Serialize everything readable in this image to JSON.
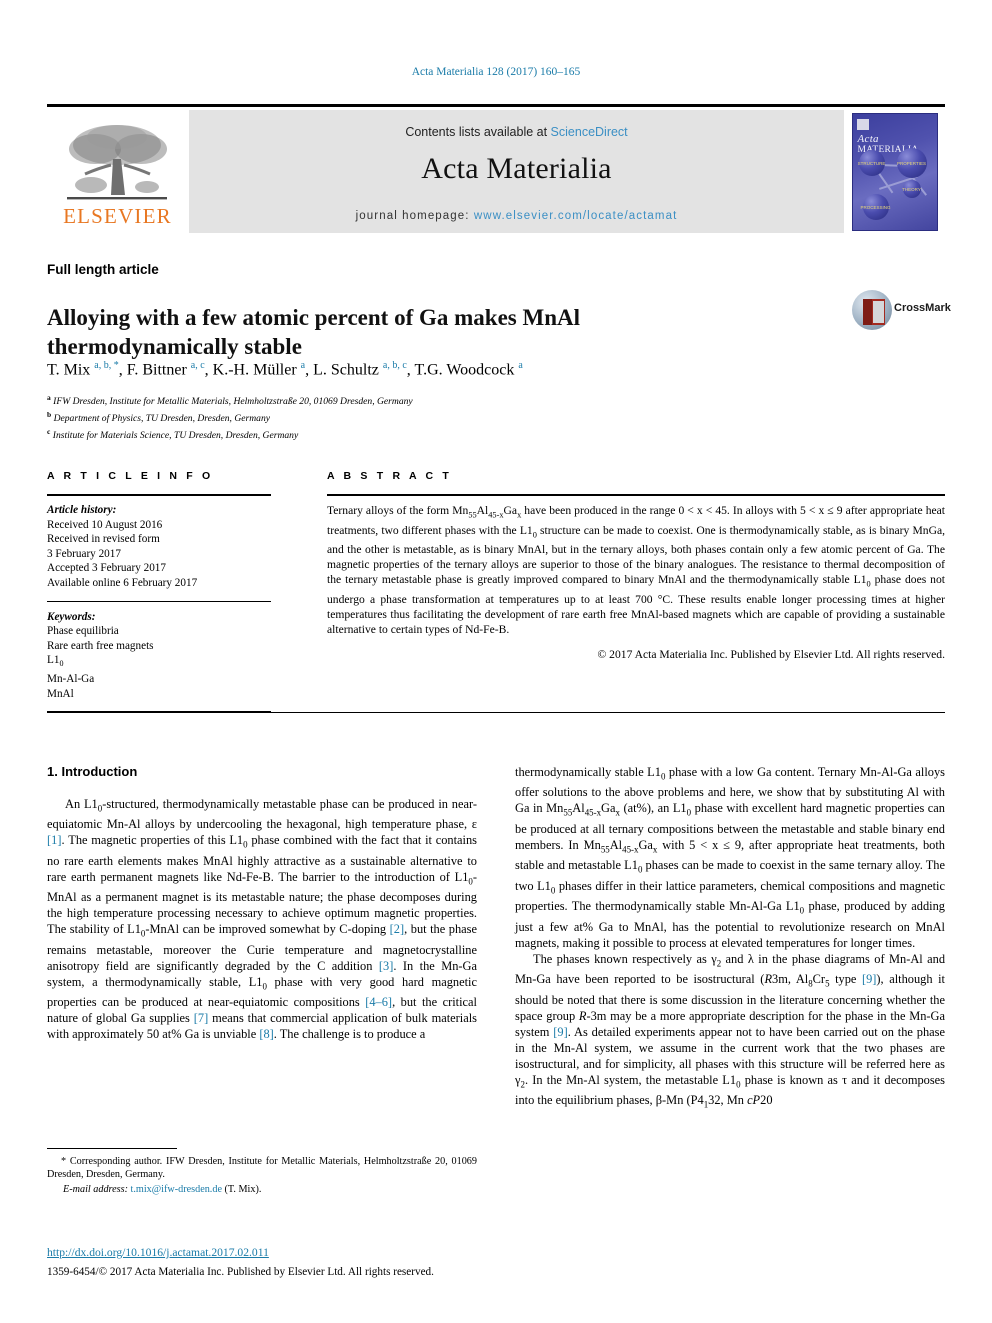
{
  "running_head": "Acta Materialia 128 (2017) 160–165",
  "masthead": {
    "publisher_logo_label": "ELSEVIER",
    "contents_prefix": "Contents lists available at ",
    "contents_link": "ScienceDirect",
    "journal_title": "Acta Materialia",
    "homepage_prefix": "journal homepage: ",
    "homepage_url": "www.elsevier.com/locate/actamat",
    "cover": {
      "title_italic": "Acta",
      "title_rest": "MATERIALIA",
      "node_labels": [
        "STRUCTURE",
        "PROPERTIES",
        "THEORY",
        "PROCESSING"
      ]
    }
  },
  "article": {
    "type": "Full length article",
    "title": "Alloying with a few atomic percent of Ga makes MnAl thermodynamically stable",
    "authors_html": "T. Mix <sup>a, b, *</sup>, F. Bittner <sup>a, c</sup>, K.-H. Müller <sup>a</sup>, L. Schultz <sup>a, b, c</sup>, T.G. Woodcock <sup>a</sup>",
    "affiliations": [
      {
        "marker": "a",
        "text": "IFW Dresden, Institute for Metallic Materials, Helmholtzstraße 20, 01069 Dresden, Germany"
      },
      {
        "marker": "b",
        "text": "Department of Physics, TU Dresden, Dresden, Germany"
      },
      {
        "marker": "c",
        "text": "Institute for Materials Science, TU Dresden, Dresden, Germany"
      }
    ],
    "crossmark_label": "CrossMark"
  },
  "info_section": {
    "heading": "A R T I C L E   I N F O",
    "history_label": "Article history:",
    "history_lines": [
      "Received 10 August 2016",
      "Received in revised form",
      "3 February 2017",
      "Accepted 3 February 2017",
      "Available online 6 February 2017"
    ],
    "keywords_label": "Keywords:",
    "keywords_html": [
      "Phase equilibria",
      "Rare earth free magnets",
      "L1<sub>0</sub>",
      "Mn-Al-Ga",
      "MnAl"
    ]
  },
  "abstract_section": {
    "heading": "A B S T R A C T",
    "body_html": "Ternary alloys of the form Mn<sub>55</sub>Al<sub>45-x</sub>Ga<sub>x</sub> have been produced in the range 0 &lt; x &lt; 45. In alloys with 5 &lt; x ≤ 9 after appropriate heat treatments, two different phases with the L1<sub>0</sub> structure can be made to coexist. One is thermodynamically stable, as is binary MnGa, and the other is metastable, as is binary MnAl, but in the ternary alloys, both phases contain only a few atomic percent of Ga. The magnetic properties of the ternary alloys are superior to those of the binary analogues. The resistance to thermal decomposition of the ternary metastable phase is greatly improved compared to binary MnAl and the thermodynamically stable L1<sub>0</sub> phase does not undergo a phase transformation at temperatures up to at least 700 °C. These results enable longer processing times at higher temperatures thus facilitating the development of rare earth free MnAl-based magnets which are capable of providing a sustainable alternative to certain types of Nd-Fe-B.",
    "copyright": "© 2017 Acta Materialia Inc. Published by Elsevier Ltd. All rights reserved."
  },
  "body": {
    "section_heading": "1. Introduction",
    "left_paragraph_html": "An L1<sub>0</sub>-structured, thermodynamically metastable phase can be produced in near-equiatomic Mn-Al alloys by undercooling the hexagonal, high temperature phase, ε <span class=\"ref\">[1]</span>. The magnetic properties of this L1<sub>0</sub> phase combined with the fact that it contains no rare earth elements makes MnAl highly attractive as a sustainable alternative to rare earth permanent magnets like Nd-Fe-B. The barrier to the introduction of L1<sub>0</sub>-MnAl as a permanent magnet is its metastable nature; the phase decomposes during the high temperature processing necessary to achieve optimum magnetic properties. The stability of L1<sub>0</sub>-MnAl can be improved somewhat by C-doping <span class=\"ref\">[2]</span>, but the phase remains metastable, moreover the Curie temperature and magnetocrystalline anisotropy field are significantly degraded by the C addition <span class=\"ref\">[3]</span>. In the Mn-Ga system, a thermodynamically stable, L1<sub>0</sub> phase with very good hard magnetic properties can be produced at near-equiatomic compositions <span class=\"ref\">[4–6]</span>, but the critical nature of global Ga supplies <span class=\"ref\">[7]</span> means that commercial application of bulk materials with approximately 50 at% Ga is unviable <span class=\"ref\">[8]</span>. The challenge is to produce a",
    "right_paragraph1_html": "thermodynamically stable L1<sub>0</sub> phase with a low Ga content. Ternary Mn-Al-Ga alloys offer solutions to the above problems and here, we show that by substituting Al with Ga in Mn<sub>55</sub>Al<sub>45-x</sub>Ga<sub>x</sub> (at%), an L1<sub>0</sub> phase with excellent hard magnetic properties can be produced at all ternary compositions between the metastable and stable binary end members. In Mn<sub>55</sub>Al<sub>45-x</sub>Ga<sub>x</sub> with 5 &lt; x ≤ 9, after appropriate heat treatments, both stable and metastable L1<sub>0</sub> phases can be made to coexist in the same ternary alloy. The two L1<sub>0</sub> phases differ in their lattice parameters, chemical compositions and magnetic properties. The thermodynamically stable Mn-Al-Ga L1<sub>0</sub> phase, produced by adding just a few at% Ga to MnAl, has the potential to revolutionize research on MnAl magnets, making it possible to process at elevated temperatures for longer times.",
    "right_paragraph2_html": "The phases known respectively as γ<sub>2</sub> and λ in the phase diagrams of Mn-Al and Mn-Ga have been reported to be isostructural (<i>R</i>3m, Al<sub>8</sub>Cr<sub>5</sub> type <span class=\"ref\">[9]</span>), although it should be noted that there is some discussion in the literature concerning whether the space group <i>R</i>-3m may be a more appropriate description for the phase in the Mn-Ga system <span class=\"ref\">[9]</span>. As detailed experiments appear not to have been carried out on the phase in the Mn-Al system, we assume in the current work that the two phases are isostructural, and for simplicity, all phases with this structure will be referred here as γ<sub>2</sub>. In the Mn-Al system, the metastable L1<sub>0</sub> phase is known as τ and it decomposes into the equilibrium phases, β-Mn (P4<sub>1</sub>32, Mn <i>cP</i>20"
  },
  "footnote": {
    "corresponding_html": "* Corresponding author. IFW Dresden, Institute for Metallic Materials, Helmholtzstraße 20, 01069 Dresden, Dresden, Germany.",
    "email_label": "E-mail address:",
    "email": "t.mix@ifw-dresden.de",
    "email_owner": "(T. Mix)."
  },
  "doi": "http://dx.doi.org/10.1016/j.actamat.2017.02.011",
  "issn_line": "1359-6454/© 2017 Acta Materialia Inc. Published by Elsevier Ltd. All rights reserved.",
  "colors": {
    "link_blue": "#1a7ba8",
    "elsevier_orange": "#e87722",
    "band_gray": "#e3e3e3"
  }
}
